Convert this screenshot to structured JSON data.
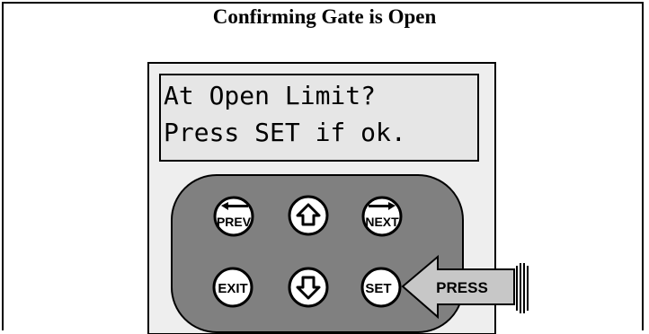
{
  "title": "Confirming Gate is Open",
  "lcd": {
    "line1": "At Open Limit?",
    "line2": "Press SET if ok."
  },
  "keys": {
    "prev": "PREV",
    "up": "up-arrow-icon",
    "next": "NEXT",
    "exit": "EXIT",
    "down": "down-arrow-icon",
    "set": "SET"
  },
  "callout": {
    "label": "PRESS"
  },
  "colors": {
    "keypad_bg": "#808080",
    "panel_bg": "#eeeeee",
    "lcd_bg": "#e6e6e6",
    "callout_fill": "#c7c7c7"
  }
}
